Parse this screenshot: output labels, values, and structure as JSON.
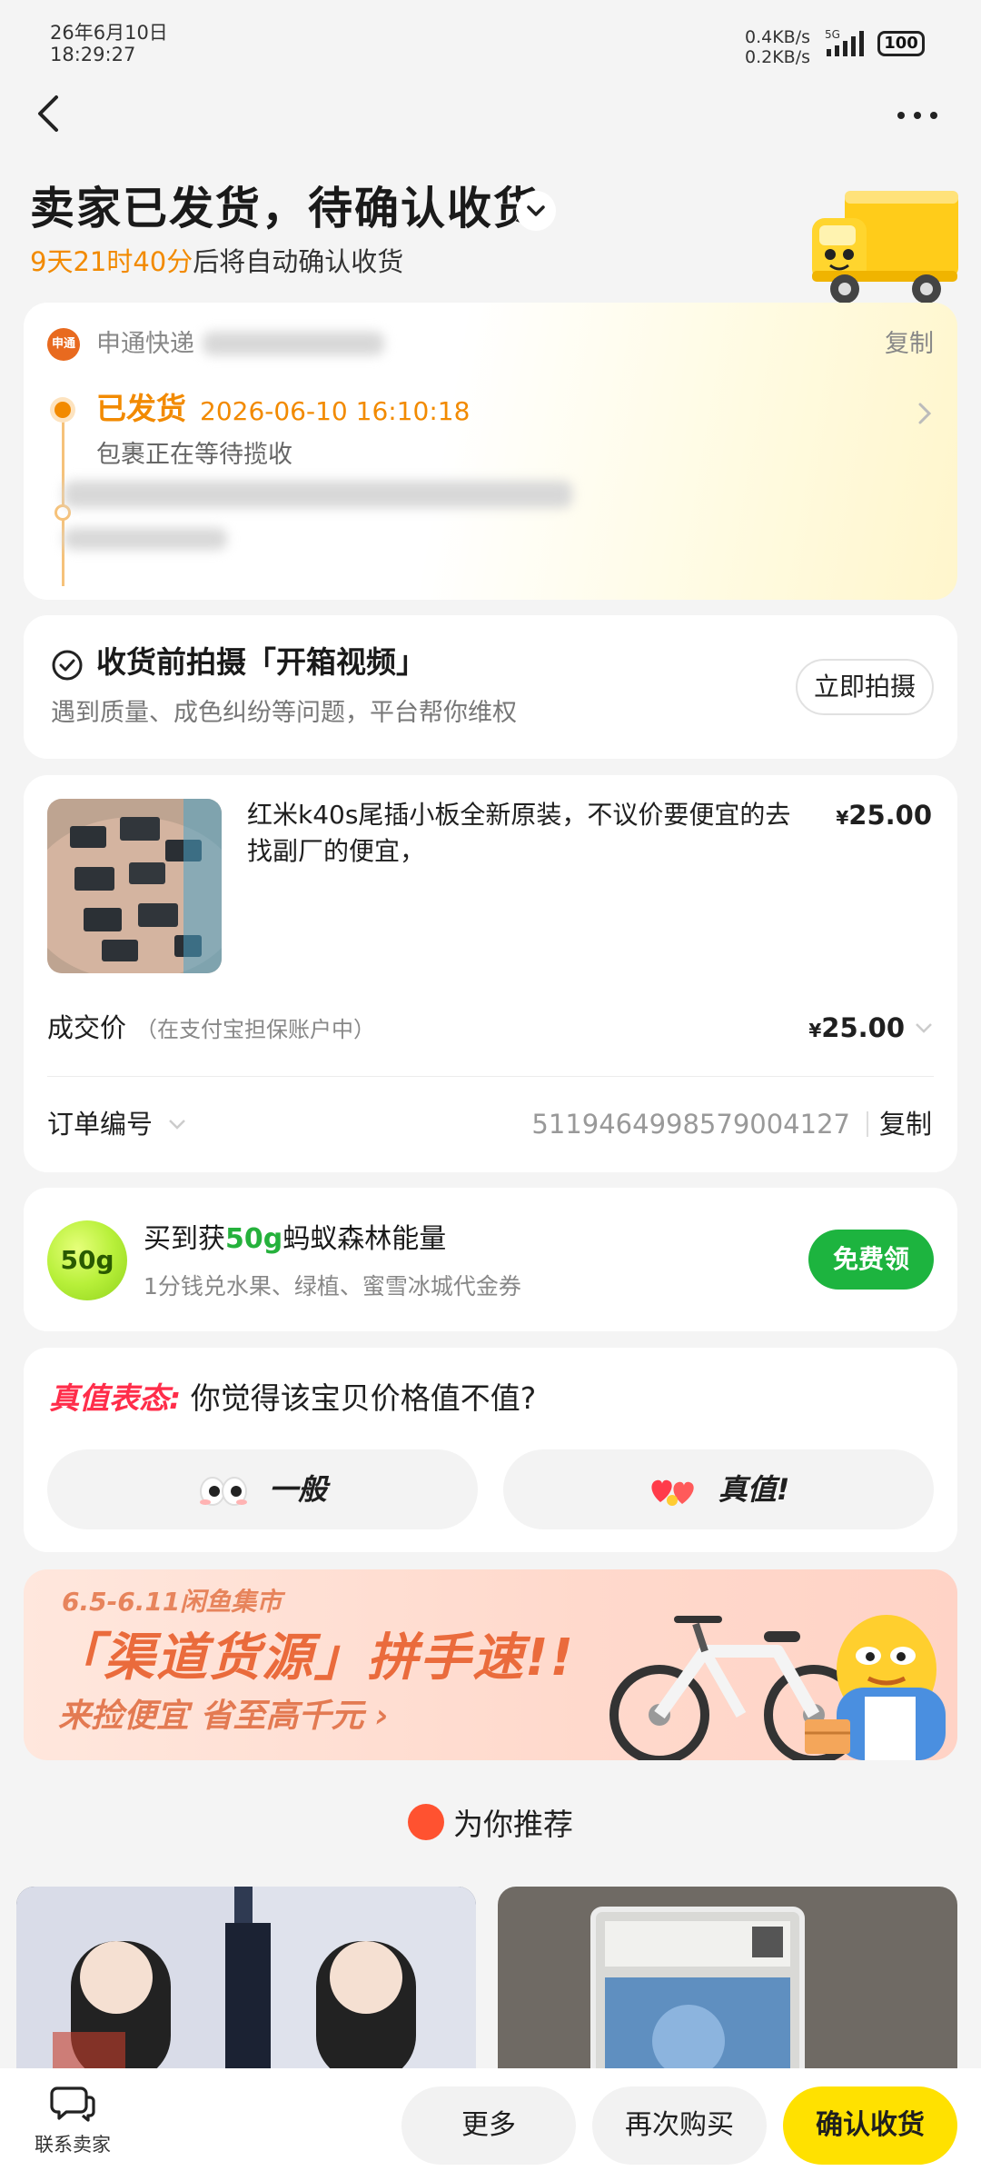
{
  "status_bar": {
    "date": "26年6月10日",
    "time": "18:29:27",
    "net_up": "0.4KB/s",
    "net_down": "0.2KB/s",
    "network": "5G",
    "battery": "100"
  },
  "header": {
    "title": "卖家已发货，待确认收货",
    "countdown": "9天21时40分",
    "countdown_suffix": "后将自动确认收货"
  },
  "logistics": {
    "courier_logo": "申通",
    "courier": "申通快递",
    "copy": "复制",
    "status": "已发货",
    "status_time": "2026-06-10 16:10:18",
    "status_desc": "包裹正在等待揽收"
  },
  "unbox": {
    "title": "收货前拍摄「开箱视频」",
    "subtitle": "遇到质量、成色纠纷等问题，平台帮你维权",
    "button": "立即拍摄"
  },
  "order": {
    "item_name": "红米k40s尾插小板全新原装，不议价要便宜的去找副厂的便宜，",
    "item_price_symbol": "¥",
    "item_price": "25.00",
    "deal_label": "成交价",
    "deal_note": "（在支付宝担保账户中）",
    "deal_price_symbol": "¥",
    "deal_price": "25.00",
    "order_no_label": "订单编号",
    "order_no": "5119464998579004127",
    "copy": "复制"
  },
  "energy": {
    "badge": "50g",
    "title_pre": "买到获",
    "title_amount": "50g",
    "title_post": "蚂蚁森林能量",
    "subtitle": "1分钱兑水果、绿植、蜜雪冰城代金券",
    "button": "免费领"
  },
  "vote": {
    "prefix": "真值表态:",
    "question": " 你觉得该宝贝价格值不值?",
    "option_normal": "一般",
    "option_worth": "真值!"
  },
  "banner": {
    "date": "6.5-6.11闲鱼集市",
    "headline": "「渠道货源」拼手速!!",
    "sub": "来捡便宜 省至高千元 ›"
  },
  "recommend": {
    "title": "为你推荐"
  },
  "bottom_bar": {
    "contact": "联系卖家",
    "more": "更多",
    "rebuy": "再次购买",
    "confirm": "确认收货"
  },
  "colors": {
    "accent_orange": "#f28a00",
    "confirm_yellow": "#ffe100",
    "energy_green": "#1db43f",
    "value_red": "#ff2d4a"
  }
}
